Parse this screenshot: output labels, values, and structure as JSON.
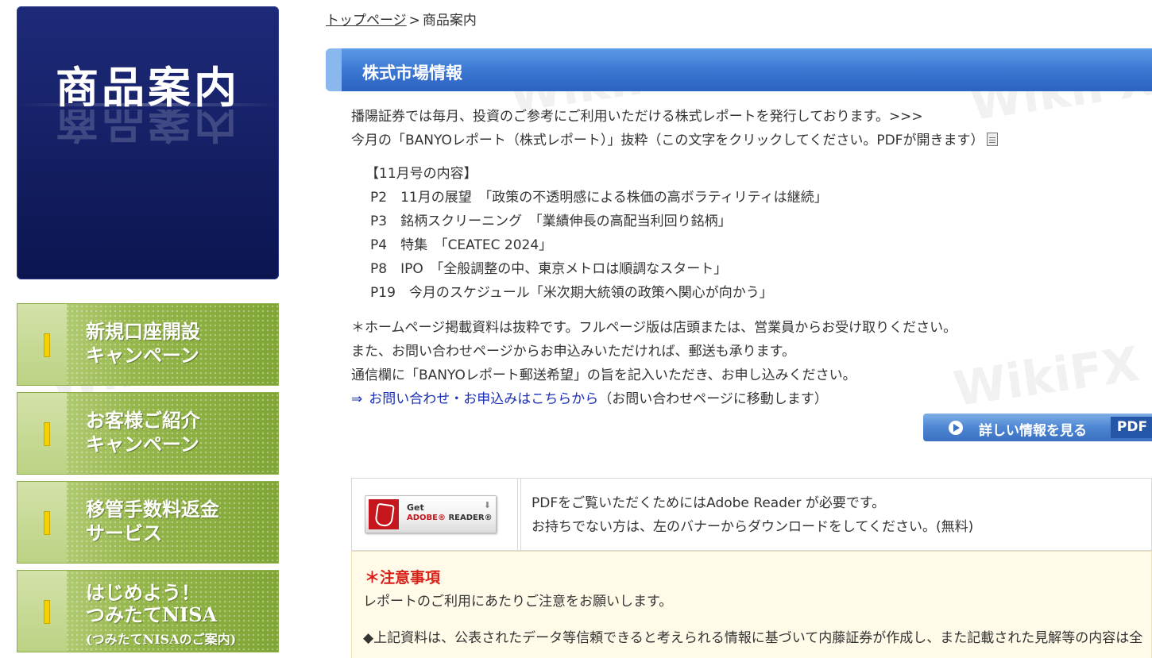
{
  "sidebar": {
    "hero_title": "商品案内",
    "items": [
      {
        "line1": "新規口座開設",
        "line2": "キャンペーン",
        "small": ""
      },
      {
        "line1": "お客様ご紹介",
        "line2": "キャンペーン",
        "small": ""
      },
      {
        "line1": "移管手数料返金",
        "line2": "サービス",
        "small": ""
      },
      {
        "line1": "はじめよう！",
        "line2": "つみたてNISA",
        "small": "(つみたてNISAのご案内)"
      }
    ]
  },
  "breadcrumb": {
    "home": "トップページ",
    "separator": ">",
    "current": "商品案内"
  },
  "section": {
    "title": "株式市場情報"
  },
  "intro": {
    "line1": "播陽証券では毎月、投資のご参考にご利用いただける株式レポートを発行しております。>>>",
    "line2": "今月の「BANYOレポート（株式レポート）」抜粋（この文字をクリックしてください。PDFが開きます）"
  },
  "contents": {
    "heading": "【11月号の内容】",
    "items": [
      "P2　11月の展望　「政策の不透明感による株価の高ボラティリティは継続」",
      "P3　銘柄スクリーニング　「業績伸長の高配当利回り銘柄」",
      "P4　特集　「CEATEC 2024」",
      "P8　IPO　「全般調整の中、東京メトロは順調なスタート」",
      "P19　今月のスケジュール「米次期大統領の政策へ関心が向かう」"
    ]
  },
  "notes": {
    "line1": "＊ホームページ掲載資料は抜粋です。フルページ版は店頭または、営業員からお受け取りください。",
    "line2": "また、お問い合わせページからお申込みいただければ、郵送も承ります。",
    "line3": "通信欄に「BANYOレポート郵送希望」の旨を記入いただき、お申し込みください。",
    "arrow": "⇒",
    "link": "お問い合わせ・お申込みはこちらから",
    "link_suffix": "（お問い合わせページに移動します）"
  },
  "detail_button": {
    "label": "詳しい情報を見る",
    "tag": "PDF"
  },
  "adobe": {
    "badge_get": "Get",
    "badge_brand": "ADOBE®",
    "badge_product": "READER®",
    "line1": "PDFをご覧いただくためにはAdobe Reader が必要です。",
    "line2": "お持ちでない方は、左のバナーからダウンロードをしてください。(無料)"
  },
  "caution": {
    "title": "＊注意事項",
    "subtitle": "レポートのご利用にあたりご注意をお願いします。",
    "body": "◆上記資料は、公表されたデータ等信頼できると考えられる情報に基づいて内藤証券が作成し、また記載された見解等の内容は全"
  },
  "colors": {
    "header_blue": "#3c78d3",
    "sidebar_navy": "#17226a",
    "sidebar_green": "#95b64a",
    "link_blue": "#1a2fb5",
    "caution_red": "#d9211a"
  }
}
